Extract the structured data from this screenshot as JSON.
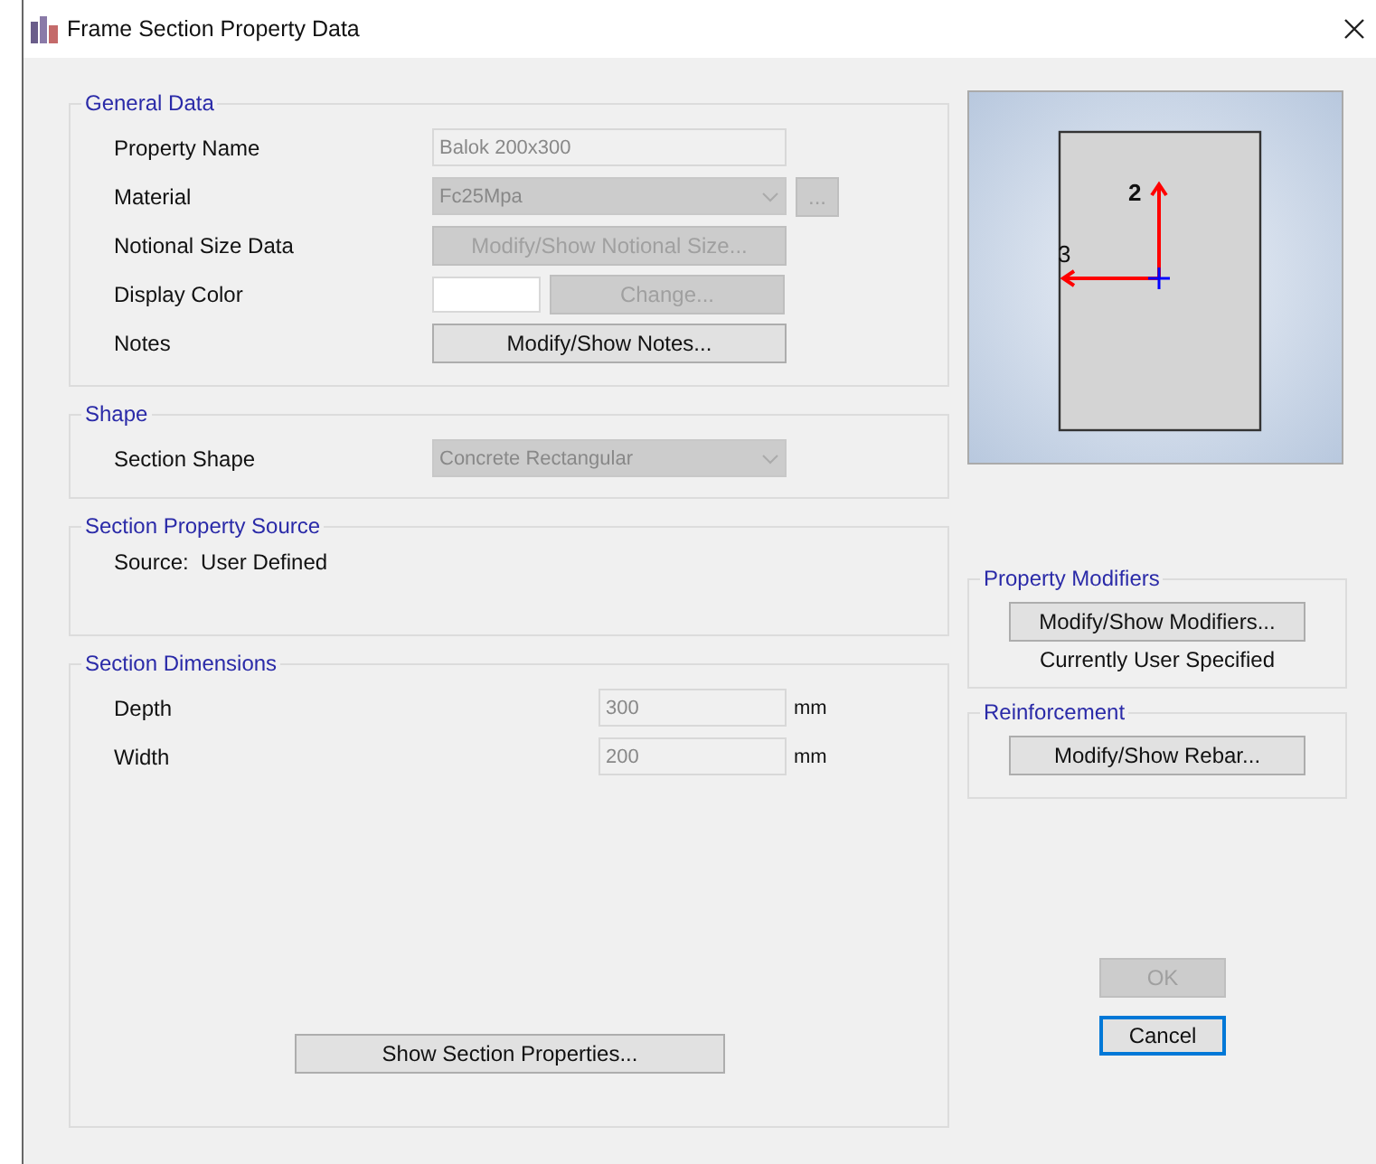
{
  "window": {
    "title": "Frame Section Property Data"
  },
  "general_data": {
    "title": "General Data",
    "rows": [
      {
        "kind": "text",
        "label": "Property Name",
        "value": "Balok 200x300",
        "disabled": true
      },
      {
        "kind": "dropdown",
        "label": "Material",
        "value": "Fc25Mpa",
        "disabled": true,
        "extra_button": "..."
      },
      {
        "kind": "button",
        "label": "Notional Size Data",
        "button": "Modify/Show Notional Size...",
        "disabled": true
      },
      {
        "kind": "color",
        "label": "Display Color",
        "button": "Change...",
        "disabled": true
      },
      {
        "kind": "button",
        "label": "Notes",
        "button": "Modify/Show Notes...",
        "disabled": false
      }
    ]
  },
  "shape": {
    "title": "Shape",
    "rows": [
      {
        "kind": "dropdown",
        "label": "Section Shape",
        "value": "Concrete Rectangular",
        "disabled": true
      }
    ]
  },
  "source": {
    "title": "Section Property Source",
    "text": "Source:  User Defined"
  },
  "dimensions": {
    "title": "Section Dimensions",
    "rows": [
      {
        "kind": "number",
        "label": "Depth",
        "value": "300",
        "unit": "mm",
        "disabled": true
      },
      {
        "kind": "number",
        "label": "Width",
        "value": "200",
        "unit": "mm",
        "disabled": true
      }
    ],
    "button": "Show Section Properties..."
  },
  "preview": {
    "axis_vertical": "2",
    "axis_horizontal": "3"
  },
  "property_modifiers": {
    "title": "Property Modifiers",
    "button": "Modify/Show Modifiers...",
    "status": "Currently User Specified"
  },
  "reinforcement": {
    "title": "Reinforcement",
    "button": "Modify/Show Rebar..."
  },
  "buttons": [
    {
      "label": "OK",
      "disabled": true,
      "default": false
    },
    {
      "label": "Cancel",
      "disabled": false,
      "default": true
    }
  ]
}
